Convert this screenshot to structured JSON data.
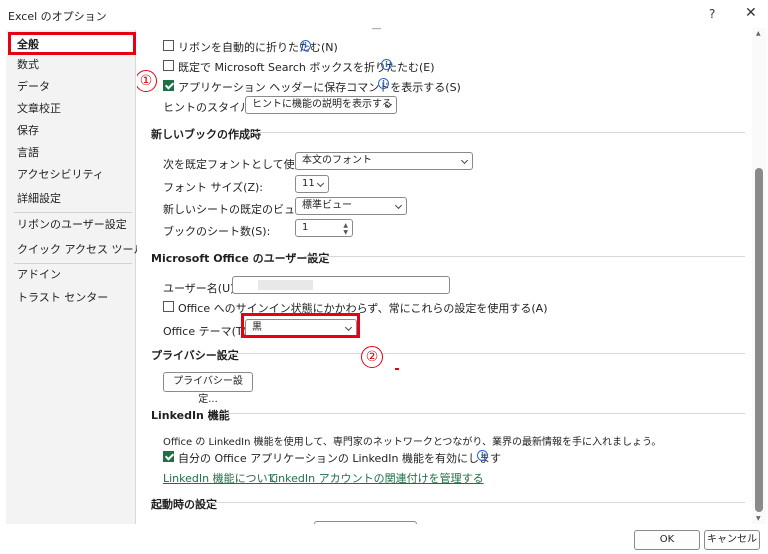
{
  "window": {
    "title": "Excel のオプション",
    "help_label": "?",
    "close_label": "✕"
  },
  "sidebar": {
    "items": [
      {
        "label": "全般"
      },
      {
        "label": "数式"
      },
      {
        "label": "データ"
      },
      {
        "label": "文章校正"
      },
      {
        "label": "保存"
      },
      {
        "label": "言語"
      },
      {
        "label": "アクセシビリティ"
      },
      {
        "label": "詳細設定"
      },
      {
        "label": "リボンのユーザー設定"
      },
      {
        "label": "クイック アクセス ツール バー"
      },
      {
        "label": "アドイン"
      },
      {
        "label": "トラスト センター"
      }
    ],
    "selected": "全般"
  },
  "top_options": {
    "collapse_ribbon": {
      "label": "リボンを自動的に折りたたむ(N)",
      "checked": false
    },
    "collapse_search": {
      "label": "既定で Microsoft Search ボックスを折りたたむ(E)",
      "checked": false
    },
    "show_save_in_header": {
      "label": "アプリケーション ヘッダーに保存コマンドを表示する(S)",
      "checked": true
    },
    "tooltip_style_label": "ヒントのスタイル(R):",
    "tooltip_style_value": "ヒントに機能の説明を表示する"
  },
  "new_workbook": {
    "title": "新しいブックの作成時",
    "default_font_label": "次を既定フォントとして使用(N):",
    "default_font_value": "本文のフォント",
    "font_size_label": "フォント サイズ(Z):",
    "font_size_value": "11",
    "default_view_label": "新しいシートの既定のビュー(V):",
    "default_view_value": "標準ビュー",
    "sheet_count_label": "ブックのシート数(S):",
    "sheet_count_value": "1"
  },
  "office_user": {
    "title": "Microsoft Office のユーザー設定",
    "username_label": "ユーザー名(U):",
    "always_use_label": "Office へのサインイン状態にかかわらず、常にこれらの設定を使用する(A)",
    "always_use_checked": false,
    "theme_label": "Office テーマ(T):",
    "theme_value": "黒"
  },
  "privacy": {
    "title": "プライバシー設定",
    "button_label": "プライバシー設定..."
  },
  "linkedin": {
    "title": "LinkedIn 機能",
    "description": "Office の LinkedIn 機能を使用して、専門家のネットワークとつながり、業界の最新情報を手に入れましょう。",
    "enable_label": "自分の Office アプリケーションの LinkedIn 機能を有効にします",
    "enable_checked": true,
    "link_about": "LinkedIn 機能について",
    "link_manage": "LinkedIn アカウントの関連付けを管理する"
  },
  "startup": {
    "title": "起動時の設定"
  },
  "annotations": {
    "badge1": "①",
    "badge2": "②"
  },
  "footer": {
    "ok_label": "OK",
    "cancel_label": "キャンセル"
  },
  "colors": {
    "annotation_red": "#e60012",
    "excel_green": "#1e7145",
    "info_blue": "#2b64c4"
  }
}
